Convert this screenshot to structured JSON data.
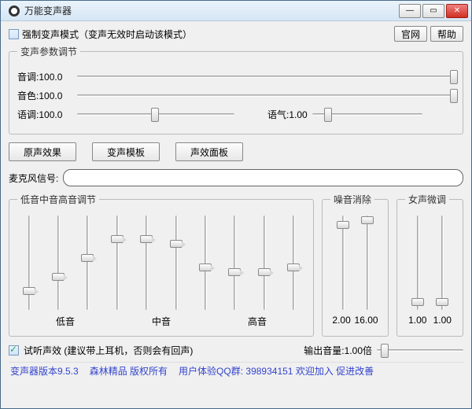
{
  "window": {
    "title": "万能变声器"
  },
  "topbar": {
    "force_mode_label": "强制变声模式（变声无效时启动该模式）",
    "official_site": "官网",
    "help": "帮助"
  },
  "params": {
    "legend": "变声参数调节",
    "pitch": {
      "label": "音调:",
      "value": "100.0",
      "pos": 1.0
    },
    "timbre": {
      "label": "音色:",
      "value": "100.0",
      "pos": 1.0
    },
    "intonation": {
      "label": "语调:",
      "value": "100.0",
      "pos": 0.5
    },
    "tone": {
      "label": "语气:",
      "value": "1.00",
      "pos": 0.15
    }
  },
  "buttons": {
    "original": "原声效果",
    "template": "变声模板",
    "sfx_panel": "声效面板"
  },
  "mic": {
    "label": "麦克风信号:"
  },
  "eq": {
    "legend": "低音中音高音调节",
    "positions": [
      0.8,
      0.65,
      0.45,
      0.25,
      0.25,
      0.3,
      0.55,
      0.6,
      0.6,
      0.55
    ],
    "labels": {
      "low": "低音",
      "mid": "中音",
      "high": "高音"
    }
  },
  "noise": {
    "legend": "噪音消除",
    "a": {
      "value": "2.00",
      "pos": 0.1
    },
    "b": {
      "value": "16.00",
      "pos": 0.05
    }
  },
  "female": {
    "legend": "女声微调",
    "a": {
      "value": "1.00",
      "pos": 0.92
    },
    "b": {
      "value": "1.00",
      "pos": 0.92
    }
  },
  "bottom": {
    "preview_label": "试听声效 (建议带上耳机，否则会有回声)",
    "output_label": "输出音量:",
    "output_value": "1.00倍",
    "output_pos": 0.1
  },
  "footer": {
    "version": "变声器版本9.5.3",
    "copyright": "森林精品 版权所有",
    "qq_label": "用户体验QQ群:",
    "qq_num": "398934151",
    "tail": "欢迎加入 促进改善"
  }
}
